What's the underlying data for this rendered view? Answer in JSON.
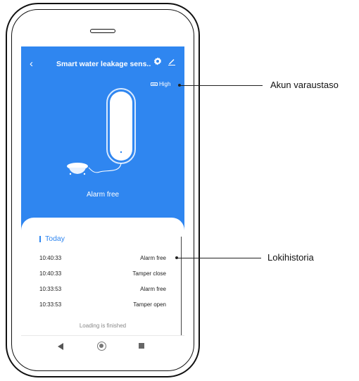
{
  "header": {
    "back_icon": "chevron-left-icon",
    "title": "Smart water leakage sens..",
    "settings_icon": "gear-icon",
    "edit_icon": "pencil-icon"
  },
  "battery": {
    "label": "High",
    "icon": "battery-icon"
  },
  "status": {
    "label": "Alarm free"
  },
  "log": {
    "section_title": "Today",
    "entries": [
      {
        "time": "10:40:33",
        "event": "Alarm free"
      },
      {
        "time": "10:40:33",
        "event": "Tamper close"
      },
      {
        "time": "10:33:53",
        "event": "Alarm free"
      },
      {
        "time": "10:33:53",
        "event": "Tamper open"
      }
    ],
    "footer": "Loading is finished"
  },
  "navbar": {
    "back_icon": "triangle-back-icon",
    "home_icon": "circle-home-icon",
    "recents_icon": "square-recents-icon"
  },
  "callouts": {
    "battery_level": "Akun varaustaso",
    "log_history": "Lokihistoria"
  },
  "colors": {
    "accent": "#2f86f0",
    "screen_bg": "#ffffff"
  }
}
